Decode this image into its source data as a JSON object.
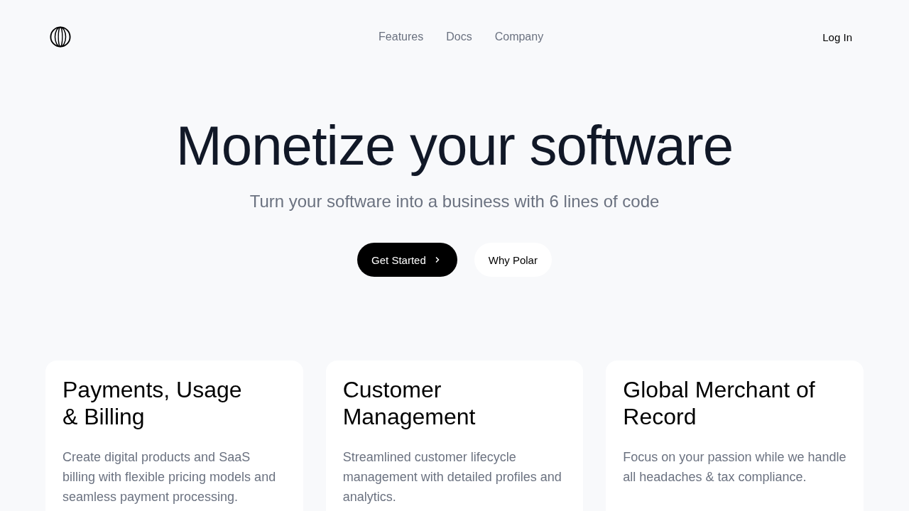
{
  "nav": {
    "links": [
      "Features",
      "Docs",
      "Company"
    ],
    "login": "Log In"
  },
  "hero": {
    "title": "Monetize your software",
    "subtitle": "Turn your software into a business with 6 lines of code",
    "buttons": [
      {
        "kind": "primary",
        "label": "Get Started"
      },
      {
        "kind": "secondary",
        "label": "Why Polar"
      }
    ]
  },
  "cards": [
    {
      "title": "Payments, Usage\n& Billing",
      "text": "Create digital products and SaaS billing with flexible pricing models and seamless payment processing."
    },
    {
      "title": "Customer\nManagement",
      "text": "Streamlined customer lifecycle management with detailed profiles and analytics."
    },
    {
      "title": "Global Merchant of\nRecord",
      "text": "Focus on your passion while we handle all headaches & tax compliance."
    }
  ]
}
